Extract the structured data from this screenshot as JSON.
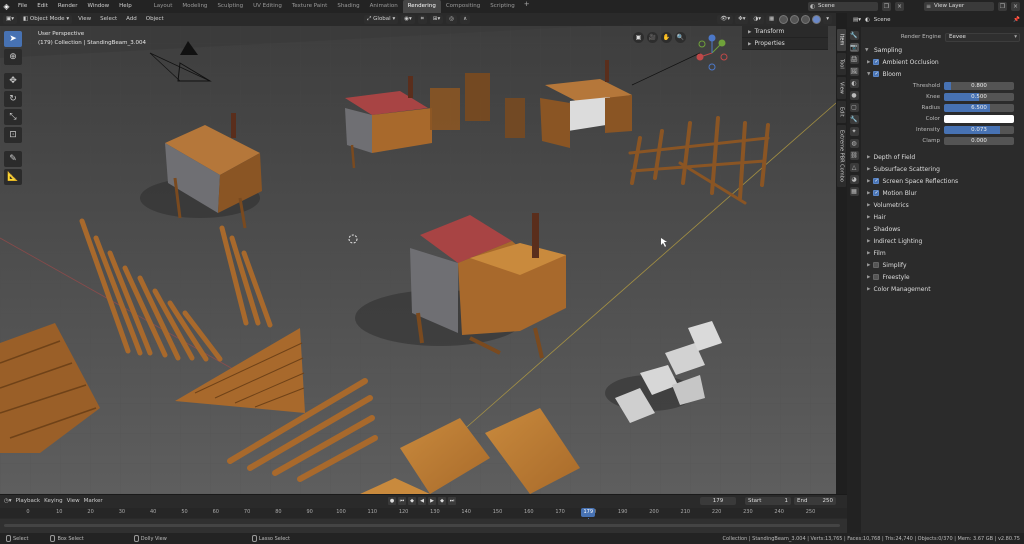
{
  "topbar": {
    "menus": [
      "File",
      "Edit",
      "Render",
      "Window",
      "Help"
    ],
    "workspaces": [
      "Layout",
      "Modeling",
      "Sculpting",
      "UV Editing",
      "Texture Paint",
      "Shading",
      "Animation",
      "Rendering",
      "Compositing",
      "Scripting"
    ],
    "active_workspace": "Rendering",
    "scene": "Scene",
    "view_layer": "View Layer"
  },
  "viewport": {
    "mode": "Object Mode",
    "menus": [
      "View",
      "Select",
      "Add",
      "Object"
    ],
    "orientation": "Global",
    "info_line1": "User Perspective",
    "info_line2": "(179) Collection | StandingBeam_3.004",
    "npanel": {
      "transform": "Transform",
      "properties": "Properties"
    }
  },
  "vertical_tabs": [
    "Item",
    "Tool",
    "View",
    "Edit",
    "Extreme PBR Combo"
  ],
  "properties": {
    "header_title": "Scene",
    "render_engine_label": "Render Engine",
    "render_engine": "Eevee",
    "sampling": "Sampling",
    "ambient_occlusion": "Ambient Occlusion",
    "bloom": "Bloom",
    "bloom_fields": [
      {
        "label": "Threshold",
        "value": "0.800",
        "fill": 0.1
      },
      {
        "label": "Knee",
        "value": "0.500",
        "fill": 0.5
      },
      {
        "label": "Radius",
        "value": "6.500",
        "fill": 0.65
      },
      {
        "label": "Intensity",
        "value": "0.073",
        "fill": 0.8
      },
      {
        "label": "Clamp",
        "value": "0.000",
        "fill": 0.0
      }
    ],
    "color_label": "Color",
    "sections": {
      "depth_of_field": "Depth of Field",
      "subsurface": "Subsurface Scattering",
      "ssr": "Screen Space Reflections",
      "motion_blur": "Motion Blur",
      "volumetrics": "Volumetrics",
      "hair": "Hair",
      "shadows": "Shadows",
      "indirect": "Indirect Lighting",
      "film": "Film",
      "simplify": "Simplify",
      "freestyle": "Freestyle",
      "color_management": "Color Management"
    }
  },
  "timeline": {
    "menus": [
      "Playback",
      "Keying",
      "View",
      "Marker"
    ],
    "current_frame": "179",
    "start_label": "Start",
    "start": "1",
    "end_label": "End",
    "end": "250",
    "ticks": [
      "0",
      "10",
      "20",
      "30",
      "40",
      "50",
      "60",
      "70",
      "80",
      "90",
      "100",
      "110",
      "120",
      "130",
      "140",
      "150",
      "160",
      "170",
      "180",
      "190",
      "200",
      "210",
      "220",
      "230",
      "240",
      "250"
    ]
  },
  "statusbar": {
    "select": "Select",
    "box_select": "Box Select",
    "dolly_view": "Dolly View",
    "lasso_select": "Lasso Select",
    "stats": "Collection | StandingBeam_3.004 | Verts:13,765 | Faces:10,768 | Tris:24,740 | Objects:0/370 | Mem: 3.67 GB | v2.80.75"
  },
  "colors": {
    "accent": "#4772b3",
    "floor": "#5c5c5c",
    "wood": "#a8692c",
    "roof_red": "#9c3a3a"
  }
}
